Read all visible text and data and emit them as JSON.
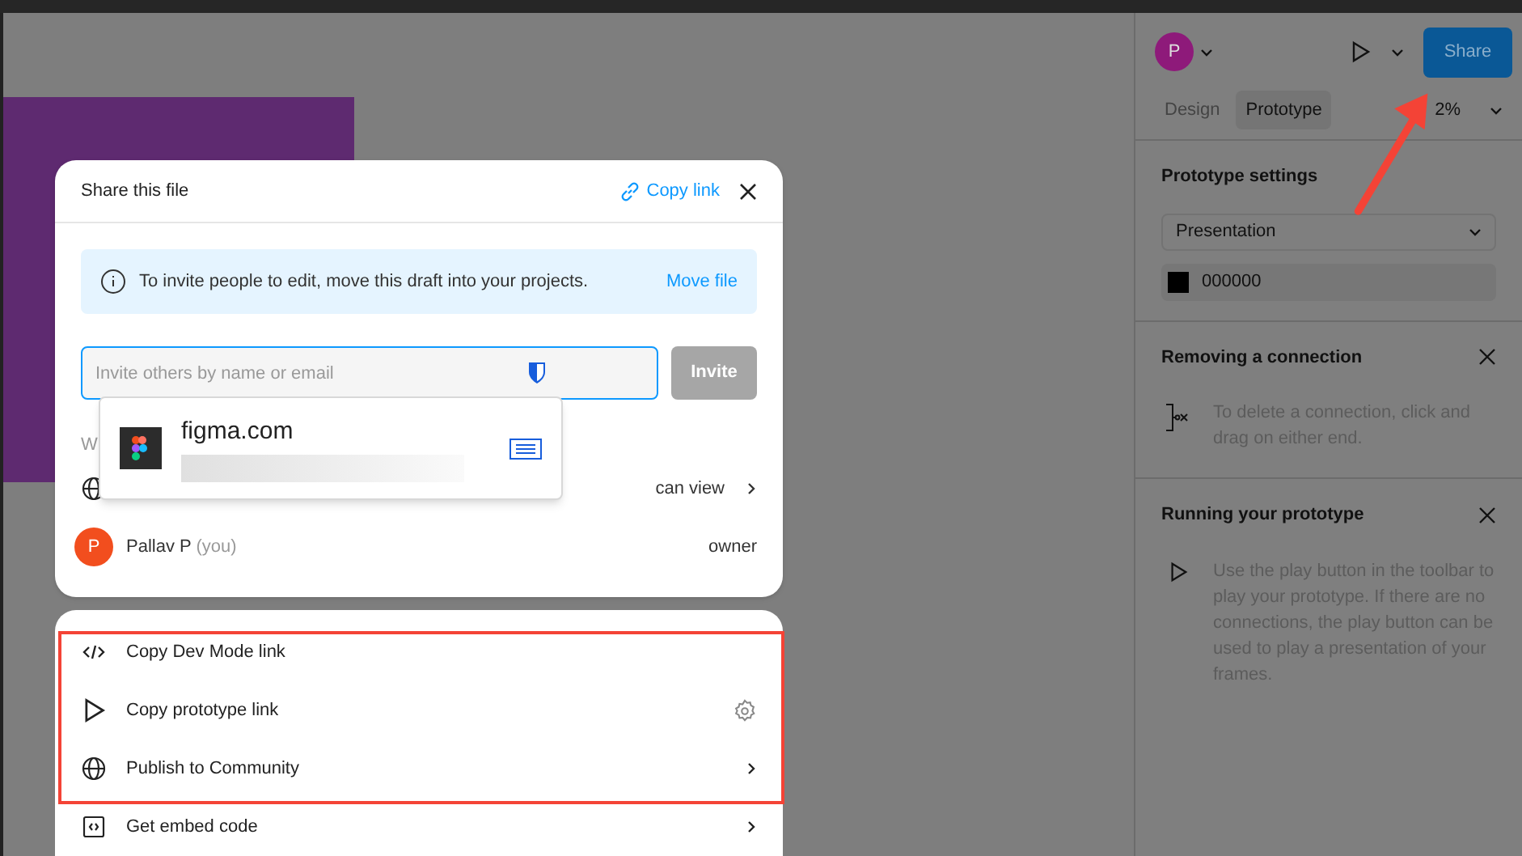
{
  "share_dialog": {
    "title": "Share this file",
    "copy_link": "Copy link",
    "notice": {
      "text": "To invite people to edit, move this draft into your projects.",
      "action": "Move file"
    },
    "invite_field": {
      "placeholder": "Invite others by name or email"
    },
    "invite_button": {
      "label": "Invite",
      "disabled": true
    },
    "hidden_label": "W",
    "autofill": {
      "site": "figma.com"
    },
    "people": [
      {
        "kind": "link",
        "role": "can view"
      },
      {
        "kind": "user",
        "avatar": "P",
        "name": "Pallav P",
        "note": "(you)",
        "role": "owner"
      }
    ]
  },
  "link_menu": {
    "items": [
      {
        "label": "Copy Dev Mode link",
        "kind": "code"
      },
      {
        "label": "Copy prototype link",
        "kind": "play"
      },
      {
        "label": "Publish to Community",
        "kind": "globe"
      },
      {
        "label": "Get embed code",
        "kind": "embed"
      }
    ]
  },
  "toolbar": {
    "avatar": "P",
    "share": "Share",
    "zoom": "2%"
  },
  "tabs": [
    {
      "label": "Design",
      "selected": false
    },
    {
      "label": "Prototype",
      "selected": true
    }
  ],
  "prototype_settings": {
    "title": "Prototype settings",
    "device": "Presentation",
    "background": "000000"
  },
  "help": [
    {
      "kind": "connection",
      "title": "Removing a connection",
      "text": "To delete a connection, click and drag on either end."
    },
    {
      "kind": "play",
      "title": "Running your prototype",
      "text": "Use the play button in the toolbar to play your prototype. If there are no connections, the play button can be used to play a presentation of your frames."
    }
  ]
}
